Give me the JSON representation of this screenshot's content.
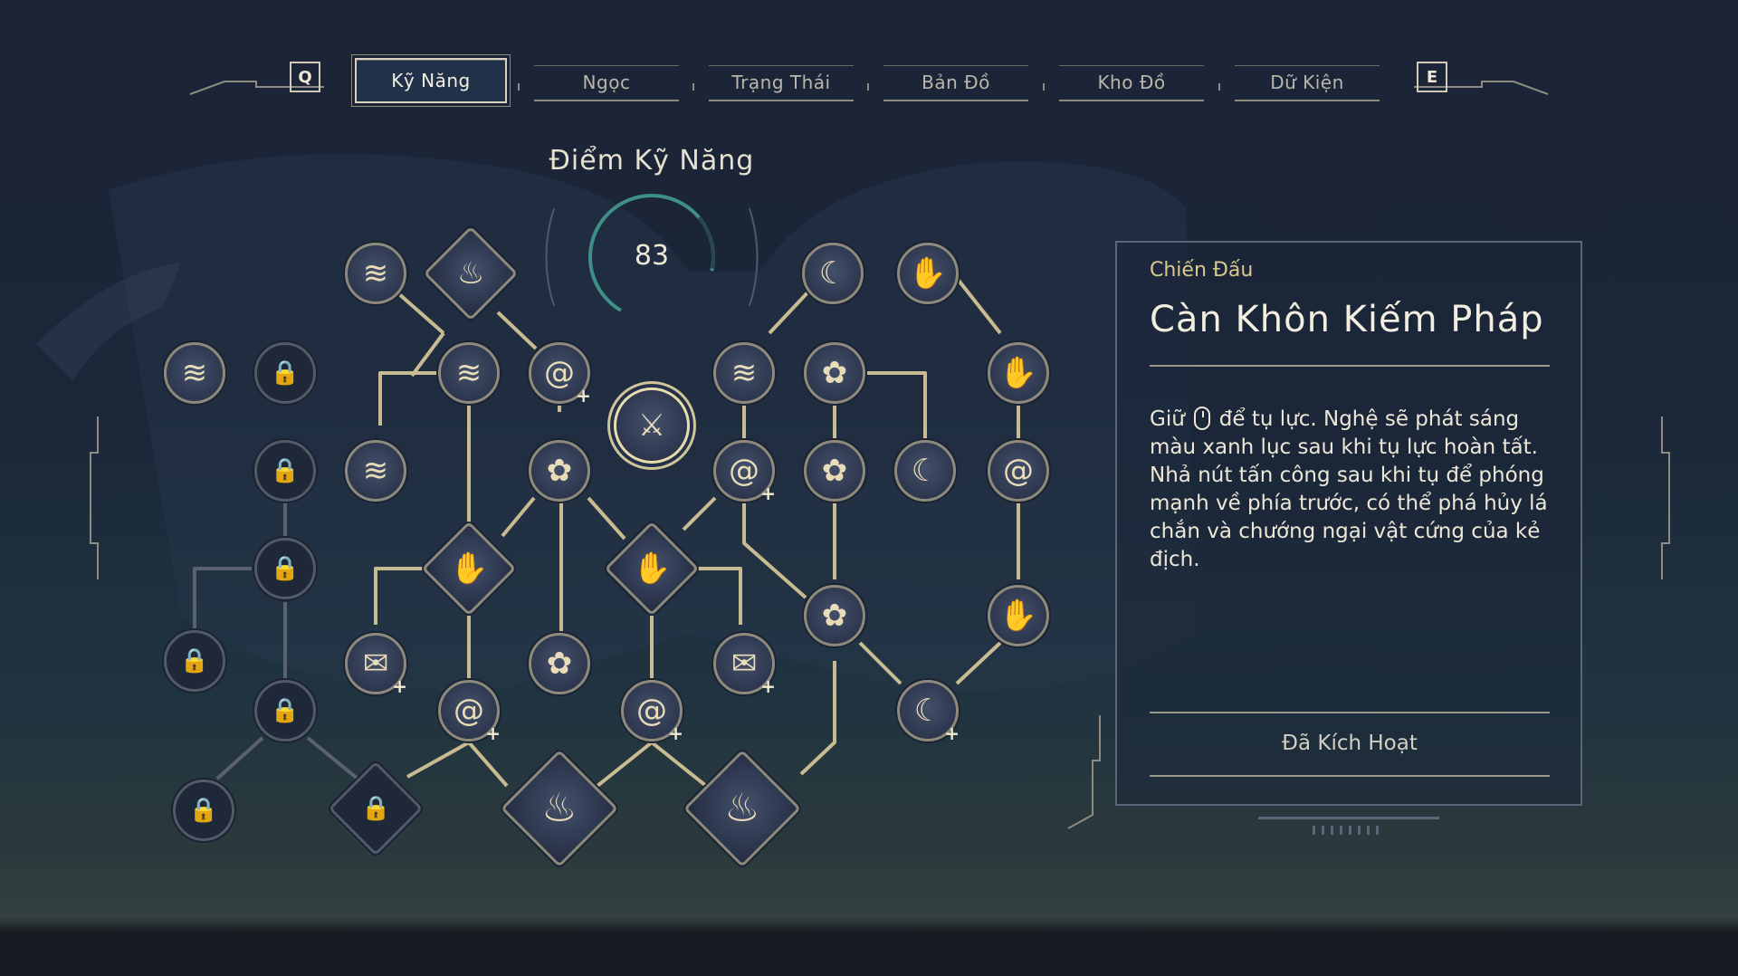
{
  "tabs": {
    "left_key": "Q",
    "right_key": "E",
    "items": [
      {
        "label": "Kỹ Năng",
        "active": true
      },
      {
        "label": "Ngọc",
        "active": false
      },
      {
        "label": "Trạng Thái",
        "active": false
      },
      {
        "label": "Bản Đồ",
        "active": false
      },
      {
        "label": "Kho Đồ",
        "active": false
      },
      {
        "label": "Dữ Kiện",
        "active": false
      }
    ]
  },
  "skill_points": {
    "title": "Điểm Kỹ Năng",
    "value": "83"
  },
  "skill_tree": {
    "glyphs": {
      "locked": "🔒",
      "wind": "≋",
      "flame": "♨",
      "swirl": "@",
      "sword": "⚔",
      "crescent": "☾",
      "flower": "✿",
      "scroll": "✉",
      "claw": "✋",
      "plus": "+"
    }
  },
  "detail": {
    "category": "Chiến Đấu",
    "title": "Càn Khôn Kiếm Pháp",
    "desc_prefix": "Giữ",
    "desc_body": "để tụ lực. Nghệ sẽ phát sáng màu xanh lục sau khi tụ lực hoàn tất. Nhả nút tấn công sau khi tụ để phóng mạnh về phía trước, có thể phá hủy lá chắn và chướng ngại vật cứng của kẻ địch.",
    "mouse_icon": "mouse-left-icon",
    "status": "Đã Kích Hoạt"
  },
  "colors": {
    "background": "#1c2438",
    "accent_gold": "#d9c98c",
    "node_border": "#8d8a7c",
    "locked_node": "#525a66"
  }
}
